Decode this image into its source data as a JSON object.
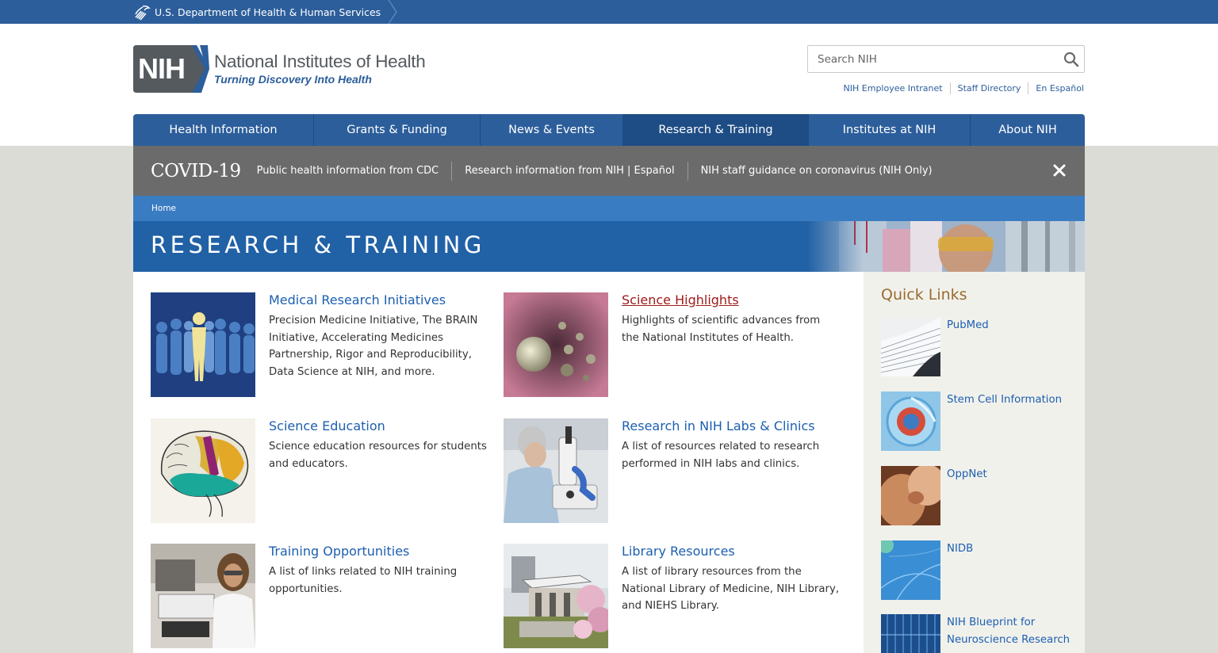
{
  "hhs": {
    "label": "U.S. Department of Health & Human Services"
  },
  "logo": {
    "mark": "NIH",
    "name": "National Institutes of Health",
    "tagline": "Turning Discovery Into Health"
  },
  "search": {
    "placeholder": "Search NIH",
    "icon": "search-icon"
  },
  "utility_links": [
    "NIH Employee Intranet",
    "Staff Directory",
    "En Español"
  ],
  "nav": {
    "items": [
      "Health Information",
      "Grants & Funding",
      "News & Events",
      "Research & Training",
      "Institutes at NIH",
      "About NIH"
    ],
    "active": "Research & Training"
  },
  "covid": {
    "title": "COVID-19",
    "links": [
      "Public health information from CDC",
      "Research information from NIH | Español",
      "NIH staff guidance on coronavirus (NIH Only)"
    ],
    "close_icon": "close-icon"
  },
  "breadcrumb": {
    "home": "Home"
  },
  "page_title": "RESEARCH & TRAINING",
  "cards": [
    {
      "title": "Medical Research Initiatives",
      "desc": "Precision Medicine Initiative, The BRAIN Initiative, Accelerating Medicines Partnership, Rigor and Reproducibility, Data Science at NIH, and more."
    },
    {
      "title": "Science Highlights",
      "desc": "Highlights of scientific advances from the National Institutes of Health."
    },
    {
      "title": "Science Education",
      "desc": "Science education resources for students and educators."
    },
    {
      "title": "Research in NIH Labs & Clinics",
      "desc": "A list of resources related to research performed in NIH labs and clinics."
    },
    {
      "title": "Training Opportunities",
      "desc": "A list of links related to NIH training opportunities."
    },
    {
      "title": "Library Resources",
      "desc": "A list of library resources from the National Library of Medicine, NIH Library, and NIEHS Library."
    }
  ],
  "quick_links": {
    "title": "Quick Links",
    "items": [
      "PubMed",
      "Stem Cell Information",
      "OppNet",
      "NIDB",
      "NIH Blueprint for Neuroscience Research"
    ]
  },
  "colors": {
    "hhs_bar": "#2c5e9b",
    "nav": "#2c5e9b",
    "nav_active": "#1e4d85",
    "covid": "#6b6b6b",
    "breadcrumb": "#3a7cc2",
    "title_banner": "#2161a6",
    "link": "#1c5fb0",
    "visited_link": "#a01a1a",
    "quick_links_title": "#9a6b2f"
  }
}
